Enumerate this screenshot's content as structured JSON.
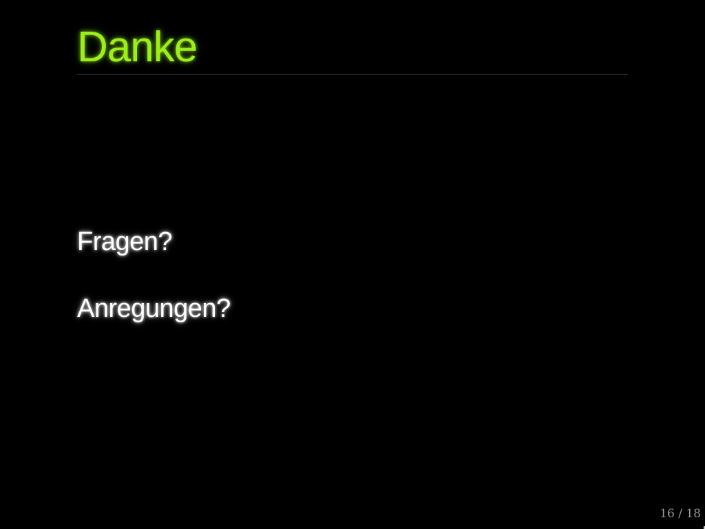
{
  "slide": {
    "title": "Danke",
    "lines": [
      "Fragen?",
      "Anregungen?"
    ],
    "page_counter": "16 / 18"
  },
  "colors": {
    "background": "#000000",
    "title": "#9cf01a",
    "body_text": "#ffffff",
    "counter": "#9a9a9a"
  }
}
